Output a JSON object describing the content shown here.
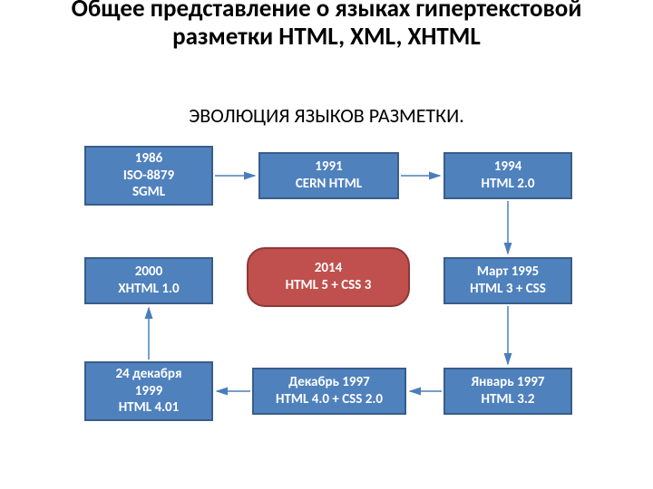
{
  "title": "Общее представление о языках гипертекстовой разметки HTML, XML, XHTML",
  "subtitle": "ЭВОЛЮЦИЯ ЯЗЫКОВ РАЗМЕТКИ.",
  "nodes": {
    "sgml": {
      "line1": "1986",
      "line2": "ISO-8879",
      "line3": "SGML"
    },
    "cern": {
      "line1": "1991",
      "line2": "CERN HTML"
    },
    "html20": {
      "line1": "1994",
      "line2": "HTML 2.0"
    },
    "xhtml": {
      "line1": "2000",
      "line2": "XHTML 1.0"
    },
    "html5": {
      "line1": "2014",
      "line2": "HTML 5 + CSS 3"
    },
    "html3": {
      "line1": "Март 1995",
      "line2": "HTML 3 +  CSS"
    },
    "html401": {
      "line1": "24 декабря",
      "line2": "1999",
      "line3": "HTML 4.01"
    },
    "html40": {
      "line1": "Декабрь 1997",
      "line2": "HTML 4.0 + CSS 2.0"
    },
    "html32": {
      "line1": "Январь 1997",
      "line2": "HTML 3.2"
    }
  }
}
